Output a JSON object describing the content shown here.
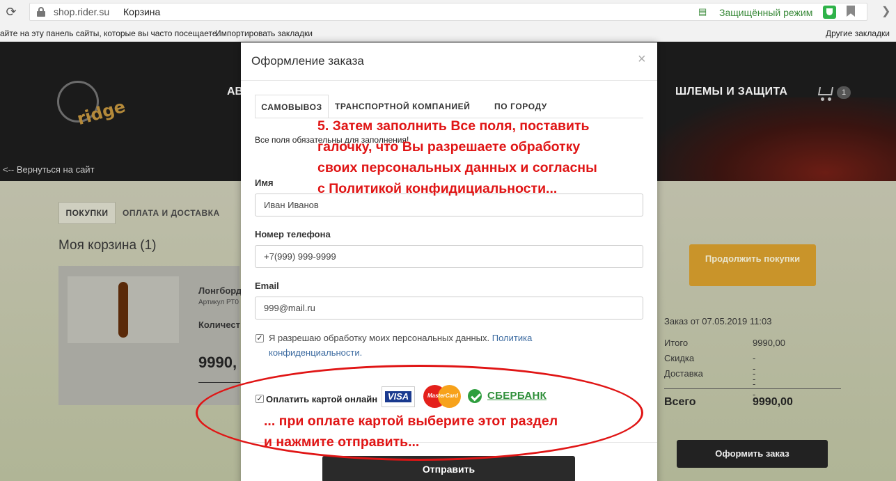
{
  "browser": {
    "reload_icon": "reload-icon",
    "url": "shop.rider.su",
    "tab_title": "Корзина",
    "incognito_label": "Защищённый режим",
    "bookmarks_hint": "айте на эту панель сайты, которые вы часто посещаете.",
    "bookmarks_import": "Импортировать закладки",
    "other_bookmarks": "Другие закладки"
  },
  "site": {
    "logo_text": "ridge",
    "nav_left": "АВ",
    "nav_helmets": "ШЛЕМЫ И ЗАЩИТА",
    "cart_count": "1",
    "back_link": "<-- Вернуться на сайт",
    "tabs": [
      "ПОКУПКИ",
      "ОПЛАТА И ДОСТАВКА"
    ],
    "cart_heading": "Моя корзина (1)",
    "product_name": "Лонгборд",
    "product_sku": "Артикул РТ0",
    "product_qty_label": "Количест",
    "product_price": "9990,",
    "continue_button": "Продолжить покупки",
    "order_date": "Заказ от 07.05.2019 11:03",
    "summary": [
      {
        "label": "Итого",
        "value": "9990,00"
      },
      {
        "label": "Скидка",
        "value": "---"
      },
      {
        "label": "Доставка",
        "value": "---"
      }
    ],
    "total_label": "Всего",
    "total_value": "9990,00",
    "checkout_button": "Оформить заказ"
  },
  "modal": {
    "title": "Оформление заказа",
    "close": "×",
    "tabs": [
      "САМОВЫВОЗ",
      "ТРАНСПОРТНОЙ КОМПАНИЕЙ",
      "ПО ГОРОДУ"
    ],
    "required_note": "Все поля обязательны для заполнения!",
    "fields": {
      "name_label": "Имя",
      "name_value": "Иван Иванов",
      "phone_label": "Номер телефона",
      "phone_value": "+7(999) 999-9999",
      "email_label": "Email",
      "email_value": "999@mail.ru"
    },
    "consent_text": "Я разрешаю обработку моих персональных данных.",
    "consent_link": "Политика конфиденциальности.",
    "consent_checked": true,
    "pay_label": "Оплатить картой онлайн",
    "pay_checked": true,
    "visa_text": "VISA",
    "mastercard_text": "MasterCard",
    "sber_text": "СБЕРБАНК",
    "send_button": "Отправить"
  },
  "annotations": {
    "step5_lines": [
      "5. Затем заполнить Все поля, поставить",
      "галочку, что Вы разрешаете обработку",
      "своих персональных данных и согласны",
      "с Политикой конфидициальности..."
    ],
    "payment_lines": [
      "... при оплате картой выберите этот раздел",
      "и нажмите отправить..."
    ],
    "color": "#e01515"
  }
}
